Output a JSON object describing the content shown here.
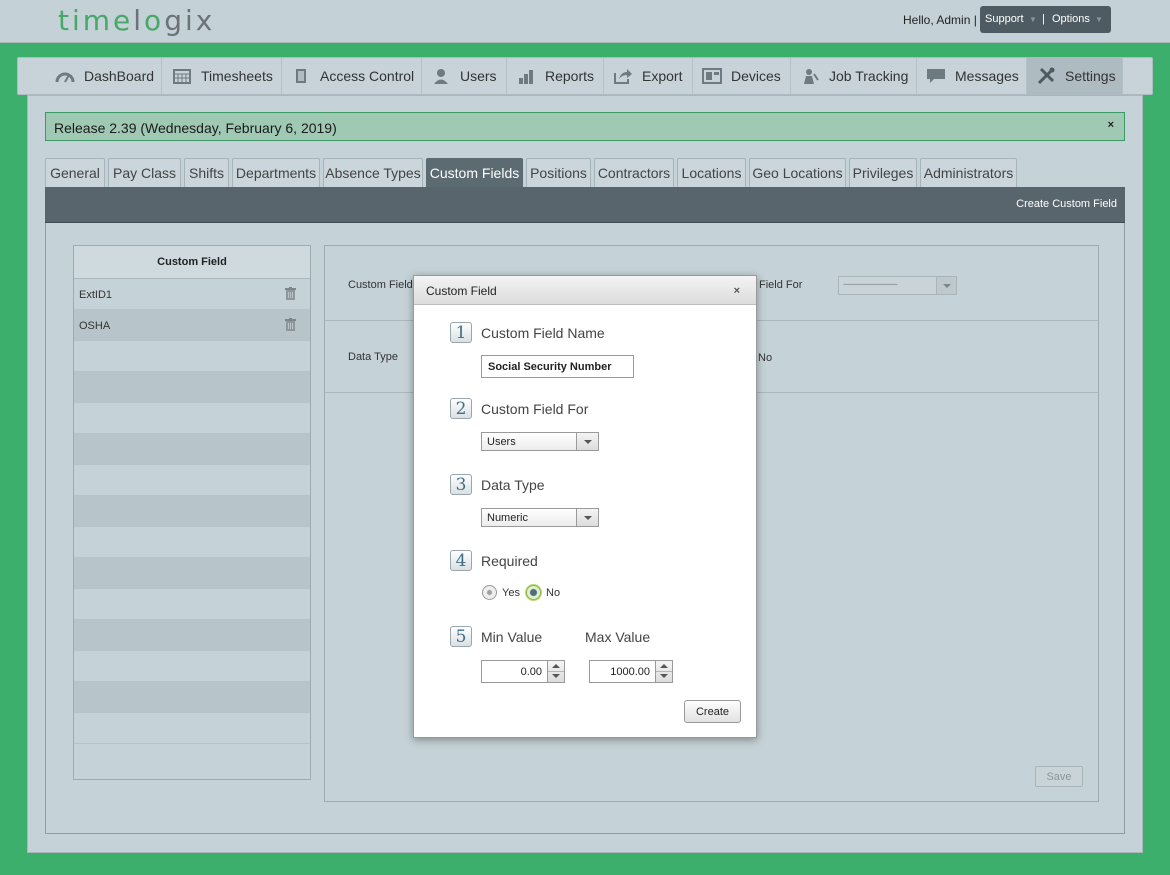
{
  "header": {
    "logo_part1": "time",
    "logo_part2": "l",
    "logo_part3": "o",
    "logo_part4": "gix",
    "greeting": "Hello, Admin |",
    "support_label": "Support",
    "options_separator": "|",
    "options_label": "Options"
  },
  "nav": {
    "items": [
      {
        "label": "DashBoard",
        "icon": "speedometer-icon"
      },
      {
        "label": "Timesheets",
        "icon": "calendar-icon"
      },
      {
        "label": "Access Control",
        "icon": "door-icon"
      },
      {
        "label": "Users",
        "icon": "user-icon"
      },
      {
        "label": "Reports",
        "icon": "bar-chart-icon"
      },
      {
        "label": "Export",
        "icon": "export-icon"
      },
      {
        "label": "Devices",
        "icon": "device-icon"
      },
      {
        "label": "Job Tracking",
        "icon": "worker-icon"
      },
      {
        "label": "Messages",
        "icon": "chat-icon"
      },
      {
        "label": "Settings",
        "icon": "tools-icon"
      }
    ],
    "active": "Settings"
  },
  "release": {
    "text": "Release 2.39 (Wednesday, February 6, 2019)",
    "close": "×"
  },
  "tabs": {
    "items": [
      "General",
      "Pay Class",
      "Shifts",
      "Departments",
      "Absence Types",
      "Custom Fields",
      "Positions",
      "Contractors",
      "Locations",
      "Geo Locations",
      "Privileges",
      "Administrators"
    ],
    "active": "Custom Fields"
  },
  "toolbar": {
    "create_label": "Create Custom Field"
  },
  "list": {
    "header": "Custom Field",
    "rows": [
      "ExtID1",
      "OSHA"
    ]
  },
  "form": {
    "custom_field_label": "Custom Field",
    "field_for_label": "Field For",
    "field_for_value": "---------------------------",
    "data_type_label": "Data Type",
    "no_label": "No",
    "save_label": "Save"
  },
  "modal": {
    "title": "Custom Field",
    "close": "×",
    "steps": [
      {
        "num": "1",
        "label": "Custom Field Name"
      },
      {
        "num": "2",
        "label": "Custom Field For"
      },
      {
        "num": "3",
        "label": "Data Type"
      },
      {
        "num": "4",
        "label": "Required"
      },
      {
        "num": "5",
        "label": "Min Value"
      }
    ],
    "max_label": "Max Value",
    "name_value": "Social Security Number",
    "field_for_value": "Users",
    "data_type_value": "Numeric",
    "required_yes": "Yes",
    "required_no": "No",
    "required_selected": "No",
    "min_value": "0.00",
    "max_value": "1000.00",
    "create_label": "Create"
  },
  "colors": {
    "brand_green": "#3daf6c",
    "accent_dark": "#58656d"
  }
}
